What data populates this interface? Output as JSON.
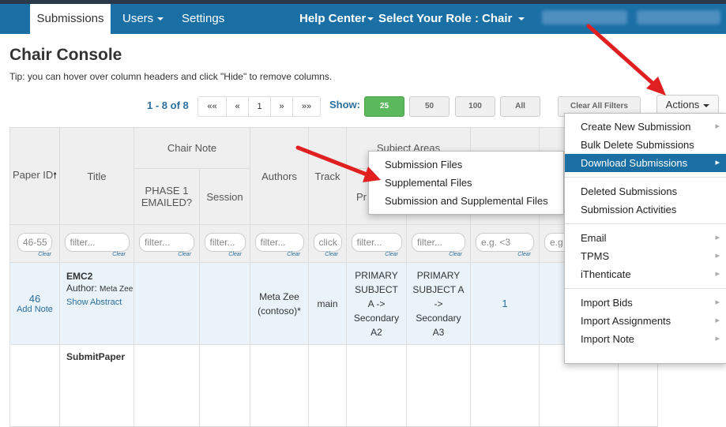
{
  "nav": {
    "tabs": [
      "Submissions",
      "Users",
      "Settings"
    ],
    "help_center": "Help Center",
    "role_label": "Select Your Role :",
    "role_value": "Chair"
  },
  "page": {
    "title": "Chair Console",
    "tip": "Tip: you can hover over column headers and click \"Hide\" to remove columns."
  },
  "pagination": {
    "range": "1 - 8 of 8",
    "buttons": [
      "««",
      "«",
      "1",
      "»",
      "»»"
    ]
  },
  "show": {
    "label": "Show:",
    "options": [
      "25",
      "50",
      "100",
      "All"
    ],
    "selected": "25"
  },
  "toolbar": {
    "clear_filters": "Clear All Filters",
    "actions": "Actions"
  },
  "table": {
    "headers": {
      "paper_id": "Paper ID",
      "title": "Title",
      "chair_note": "Chair Note",
      "phase1": "PHASE 1 EMAILED?",
      "session": "Session",
      "authors": "Authors",
      "track": "Track",
      "subject_areas": "Subject Areas",
      "primary_frag": "Pr",
      "right_frag": "s"
    },
    "filters": {
      "paper_id": "46-55",
      "filter": "filter...",
      "track": "click",
      "numeric": "e.g. <3",
      "numeric_frag": "e.g",
      "clear": "Clear"
    },
    "row1": {
      "id": "46",
      "add_note": "Add Note",
      "title": "EMC2",
      "author_label": "Author:",
      "author_name": "Meta Zee",
      "show_abstract": "Show Abstract",
      "authors": "Meta Zee (contoso)*",
      "track": "main",
      "subject_primary": "PRIMARY SUBJECT A -> Secondary A2",
      "subject_secondary": "PRIMARY SUBJECT A -> Secondary A3",
      "count": "1"
    },
    "row2": {
      "title": "SubmitPaper"
    }
  },
  "download_submenu": [
    "Submission Files",
    "Supplemental Files",
    "Submission and Supplemental Files"
  ],
  "actions_menu": {
    "group1": [
      "Create New Submission",
      "Bulk Delete Submissions",
      "Download Submissions"
    ],
    "group2": [
      "Deleted Submissions",
      "Submission Activities"
    ],
    "group3": [
      "Email",
      "TPMS",
      "iThenticate"
    ],
    "group4": [
      "Import Bids",
      "Import Assignments",
      "Import Note"
    ],
    "highlighted": "Download Submissions"
  },
  "colors": {
    "nav_bg": "#1a6fa5",
    "accent": "#2a6f9f",
    "show_active": "#5cb85c",
    "arrow": "#e02020"
  }
}
